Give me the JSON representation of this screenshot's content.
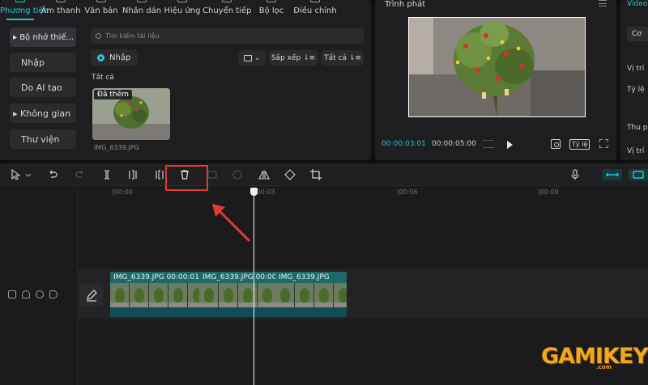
{
  "media_panel": {
    "tabs": [
      {
        "label": "Phương tiện",
        "active": true
      },
      {
        "label": "Âm thanh"
      },
      {
        "label": "Văn bản"
      },
      {
        "label": "Nhãn dán"
      },
      {
        "label": "Hiệu ứng"
      },
      {
        "label": "Chuyển tiếp"
      },
      {
        "label": "Bộ lọc"
      },
      {
        "label": "Điều chỉnh"
      }
    ],
    "side_menu": [
      {
        "label": "▸ Bộ nhớ thiế..."
      },
      {
        "label": "Nhập"
      },
      {
        "label": "Do AI tạo"
      },
      {
        "label": "▸ Không gian"
      },
      {
        "label": "Thư viện"
      }
    ],
    "search_placeholder": "Tìm kiếm tài liệu",
    "import_label": "Nhập",
    "view_caret": "⌄",
    "sort_label": "Sắp xếp ⇂≡",
    "filter_label": "Tất cả ⇂≡",
    "all_label": "Tất cả",
    "thumb_badge": "Đã thêm",
    "filename": "IMG_6339.JPG"
  },
  "player": {
    "title": "Trình phát",
    "time_current": "00:00:03:01",
    "time_total": "00:00:05:00",
    "ratio_label": "Tỷ lệ"
  },
  "props_panel": {
    "tab": "Video",
    "button": "Cơ",
    "rows": [
      "Vị trí",
      "Tỷ lệ",
      "Thu p",
      "Vị trí"
    ]
  },
  "timeline": {
    "ruler_ticks": [
      "|00:00",
      "|00:03",
      "|00:06",
      "|00:09"
    ],
    "clips": [
      {
        "label": "IMG_6339.JPG  00:00:01"
      },
      {
        "label": "IMG_6339.JPG  00:00:0"
      },
      {
        "label": "IMG_6339.JPG"
      }
    ]
  },
  "watermark": {
    "brand": "GAMIKEY",
    "sub": ".com"
  },
  "colors": {
    "accent": "#27c3d3",
    "clip": "#1b5e60",
    "highlight": "#e53935",
    "watermark": "#f2a81d"
  }
}
